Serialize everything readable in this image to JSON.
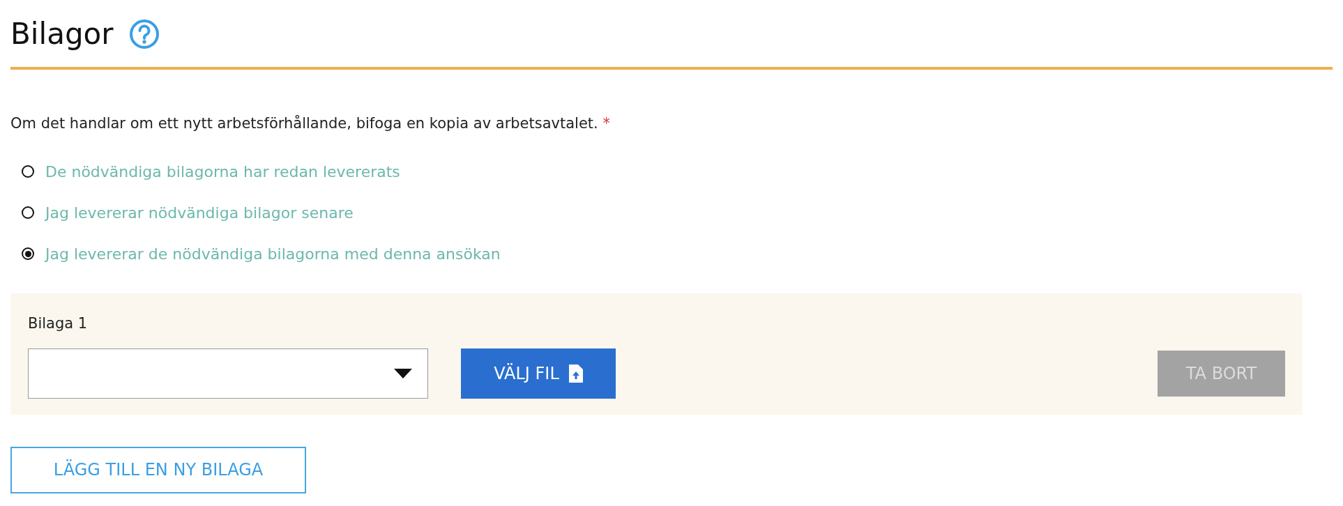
{
  "section": {
    "title": "Bilagor"
  },
  "question": {
    "text": "Om det handlar om ett nytt arbetsförhållande, bifoga en kopia av arbetsavtalet.",
    "required_mark": "*"
  },
  "options": [
    {
      "label": "De nödvändiga bilagorna har redan levererats",
      "selected": false
    },
    {
      "label": "Jag levererar nödvändiga bilagor senare",
      "selected": false
    },
    {
      "label": "Jag levererar de nödvändiga bilagorna med denna ansökan",
      "selected": true
    }
  ],
  "attachments": [
    {
      "label": "Bilaga 1",
      "choose_button": "VÄLJ FIL",
      "remove_button": {
        "label": "TA BORT",
        "disabled": true
      }
    }
  ],
  "add_button": "LÄGG TILL EN NY BILAGA"
}
